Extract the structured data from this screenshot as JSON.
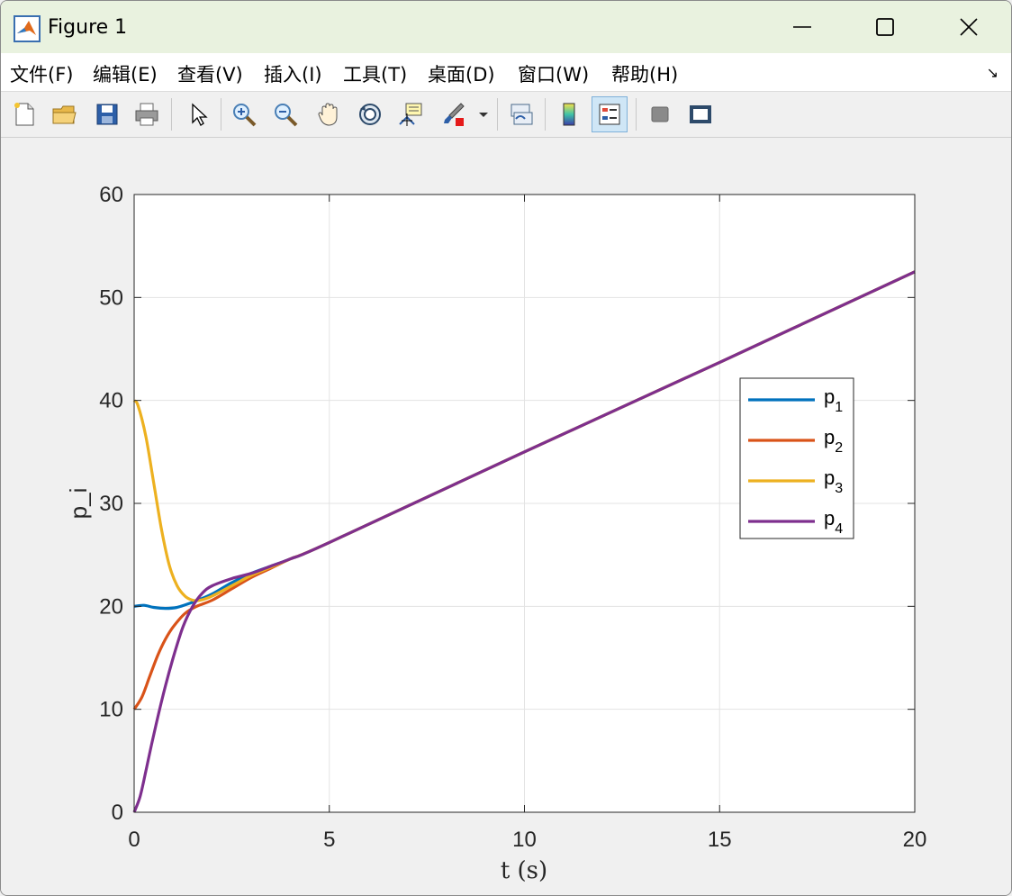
{
  "window": {
    "title": "Figure 1",
    "minimize_icon": "minimize-icon",
    "maximize_icon": "maximize-icon",
    "close_icon": "close-icon"
  },
  "menu": {
    "items": [
      "文件(F)",
      "编辑(E)",
      "查看(V)",
      "插入(I)",
      "工具(T)",
      "桌面(D)",
      "窗口(W)",
      "帮助(H)"
    ],
    "dock_icon": "dock-arrow-icon"
  },
  "toolbar": {
    "buttons": [
      "new-figure-icon",
      "open-file-icon",
      "save-icon",
      "print-icon",
      "edit-plot-pointer-icon",
      "zoom-in-icon",
      "zoom-out-icon",
      "pan-hand-icon",
      "rotate-3d-icon",
      "data-cursor-icon",
      "brush-icon",
      "link-plot-icon",
      "colorbar-icon",
      "legend-icon",
      "hide-plot-tools-icon",
      "show-plot-tools-icon"
    ]
  },
  "chart_data": {
    "type": "line",
    "xlabel": "t (s)",
    "ylabel": "p_i",
    "xlim": [
      0,
      20
    ],
    "ylim": [
      0,
      60
    ],
    "xticks": [
      "0",
      "5",
      "10",
      "15",
      "20"
    ],
    "yticks": [
      "0",
      "10",
      "20",
      "30",
      "40",
      "50",
      "60"
    ],
    "grid": true,
    "legend_position": "right",
    "series": [
      {
        "name": "p1",
        "label_base": "p",
        "label_sub": "1",
        "color": "#0072BD",
        "x": [
          0,
          0.25,
          0.5,
          0.8,
          1.1,
          1.5,
          2.0,
          2.5,
          3.0,
          3.5,
          4.0,
          5.0,
          10,
          15,
          20
        ],
        "y": [
          20.0,
          20.1,
          19.9,
          19.8,
          19.9,
          20.4,
          21.2,
          22.3,
          23.2,
          23.9,
          24.6,
          26.2,
          35.0,
          43.7,
          52.5
        ]
      },
      {
        "name": "p2",
        "label_base": "p",
        "label_sub": "2",
        "color": "#D95319",
        "x": [
          0,
          0.2,
          0.4,
          0.6,
          0.8,
          1.0,
          1.3,
          1.6,
          2.0,
          2.5,
          3.0,
          3.5,
          4.0,
          5.0,
          10,
          15,
          20
        ],
        "y": [
          10.0,
          11.2,
          13.2,
          15.2,
          16.8,
          18.0,
          19.3,
          20.0,
          20.6,
          21.7,
          22.8,
          23.7,
          24.6,
          26.2,
          35.0,
          43.7,
          52.5
        ]
      },
      {
        "name": "p3",
        "label_base": "p",
        "label_sub": "3",
        "color": "#EDB120",
        "x": [
          0,
          0.1,
          0.3,
          0.5,
          0.7,
          0.9,
          1.1,
          1.3,
          1.5,
          1.7,
          2.0,
          2.5,
          3.0,
          3.5,
          4.0,
          5.0,
          10,
          15,
          20
        ],
        "y": [
          40.0,
          39.5,
          36.5,
          32.0,
          27.5,
          24.0,
          22.0,
          21.0,
          20.6,
          20.6,
          21.0,
          22.0,
          23.0,
          23.8,
          24.6,
          26.2,
          35.0,
          43.7,
          52.5
        ]
      },
      {
        "name": "p4",
        "label_base": "p",
        "label_sub": "4",
        "color": "#7E2F8E",
        "x": [
          0,
          0.15,
          0.3,
          0.5,
          0.75,
          1.0,
          1.25,
          1.5,
          1.75,
          2.0,
          2.5,
          3.0,
          3.5,
          4.0,
          5.0,
          10,
          15,
          20
        ],
        "y": [
          0.0,
          1.5,
          4.0,
          7.5,
          11.5,
          15.0,
          18.0,
          20.0,
          21.3,
          22.0,
          22.7,
          23.2,
          23.9,
          24.6,
          26.2,
          35.0,
          43.7,
          52.5
        ]
      }
    ]
  }
}
